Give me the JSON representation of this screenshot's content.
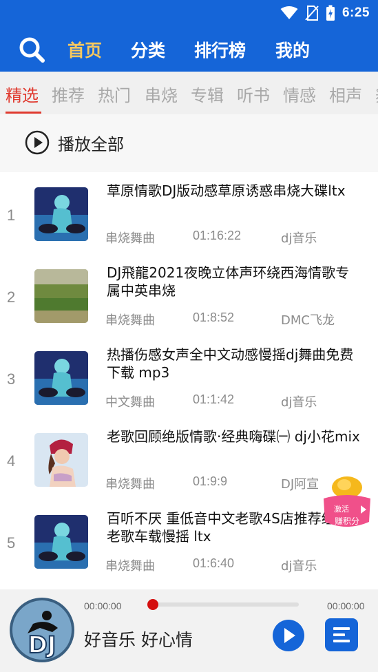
{
  "status": {
    "time": "6:25"
  },
  "nav": {
    "items": [
      {
        "label": "首页",
        "active": true
      },
      {
        "label": "分类",
        "active": false
      },
      {
        "label": "排行榜",
        "active": false
      },
      {
        "label": "我的",
        "active": false
      }
    ]
  },
  "tabs": [
    "精选",
    "推荐",
    "热门",
    "串烧",
    "专辑",
    "听书",
    "情感",
    "相声",
    "舞"
  ],
  "active_tab": "精选",
  "play_all": {
    "label": "播放全部"
  },
  "songs": [
    {
      "index": "1",
      "title": "草原情歌DJ版动感草原诱惑串烧大碟ltx",
      "category": "串烧舞曲",
      "duration": "01:16:22",
      "source": "dj音乐",
      "thumb": "dj-girl"
    },
    {
      "index": "2",
      "title": "DJ飛龍2021夜晚立体声环绕西海情歌专属中英串烧",
      "category": "串烧舞曲",
      "duration": "01:8:52",
      "source": "DMC飞龙",
      "thumb": "landscape"
    },
    {
      "index": "3",
      "title": "热播伤感女声全中文动感慢摇dj舞曲免费下载 mp3",
      "category": "中文舞曲",
      "duration": "01:1:42",
      "source": "dj音乐",
      "thumb": "dj-girl"
    },
    {
      "index": "4",
      "title": "老歌回顾绝版情歌·经典嗨碟㈠ dj小花mix",
      "category": "串烧舞曲",
      "duration": "01:9:9",
      "source": "DJ阿宣",
      "thumb": "woman"
    },
    {
      "index": "5",
      "title": "百听不厌 重低音中文老歌4S店推荐经典老歌车载慢摇 ltx",
      "category": "串烧舞曲",
      "duration": "01:6:40",
      "source": "dj音乐",
      "thumb": "dj-girl"
    }
  ],
  "badge": {
    "line1": "激活",
    "line2": "赚积分"
  },
  "player": {
    "time_current": "00:00:00",
    "time_total": "00:00:00",
    "progress": 0,
    "slogan": "好音乐 好心情",
    "avatar_text": "DJ"
  },
  "colors": {
    "primary": "#1565d8",
    "accent": "#e03a2f",
    "nav_active": "#f6c85f"
  }
}
